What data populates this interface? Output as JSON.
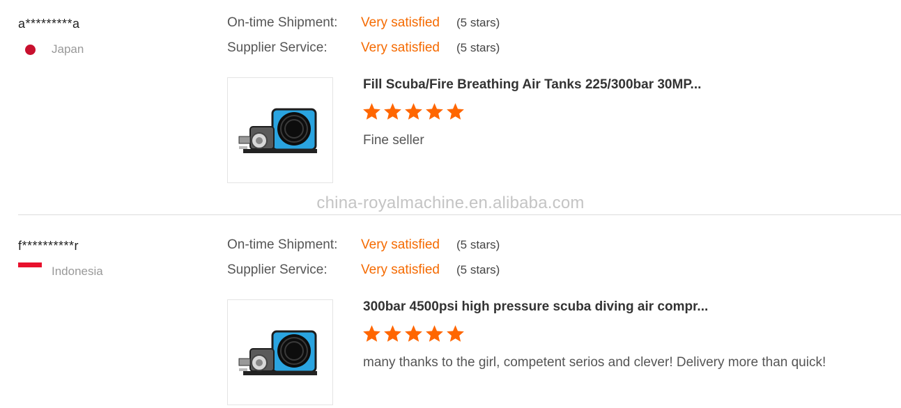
{
  "reviews": [
    {
      "buyer": "a*********a",
      "country": "Japan",
      "country_flag": "japan-flag-icon",
      "ontime_label": "On-time Shipment:",
      "ontime_value": "Very satisfied",
      "ontime_stars": "(5 stars)",
      "service_label": "Supplier Service:",
      "service_value": "Very satisfied",
      "service_stars": "(5 stars)",
      "product_title": "Fill Scuba/Fire Breathing Air Tanks 225/300bar 30MP...",
      "rating": 5,
      "comment": "Fine seller"
    },
    {
      "buyer": "f**********r",
      "country": "Indonesia",
      "country_flag": "indonesia-flag-icon",
      "ontime_label": "On-time Shipment:",
      "ontime_value": "Very satisfied",
      "ontime_stars": "(5 stars)",
      "service_label": "Supplier Service:",
      "service_value": "Very satisfied",
      "service_stars": "(5 stars)",
      "product_title": "300bar 4500psi high pressure scuba diving air compr...",
      "rating": 5,
      "comment": "many thanks to the girl, competent serios and clever! Delivery more than quick!"
    }
  ],
  "watermark": "china-royalmachine.en.alibaba.com",
  "colors": {
    "accent": "#f56a00",
    "star": "#ff6600",
    "muted": "#999999"
  }
}
